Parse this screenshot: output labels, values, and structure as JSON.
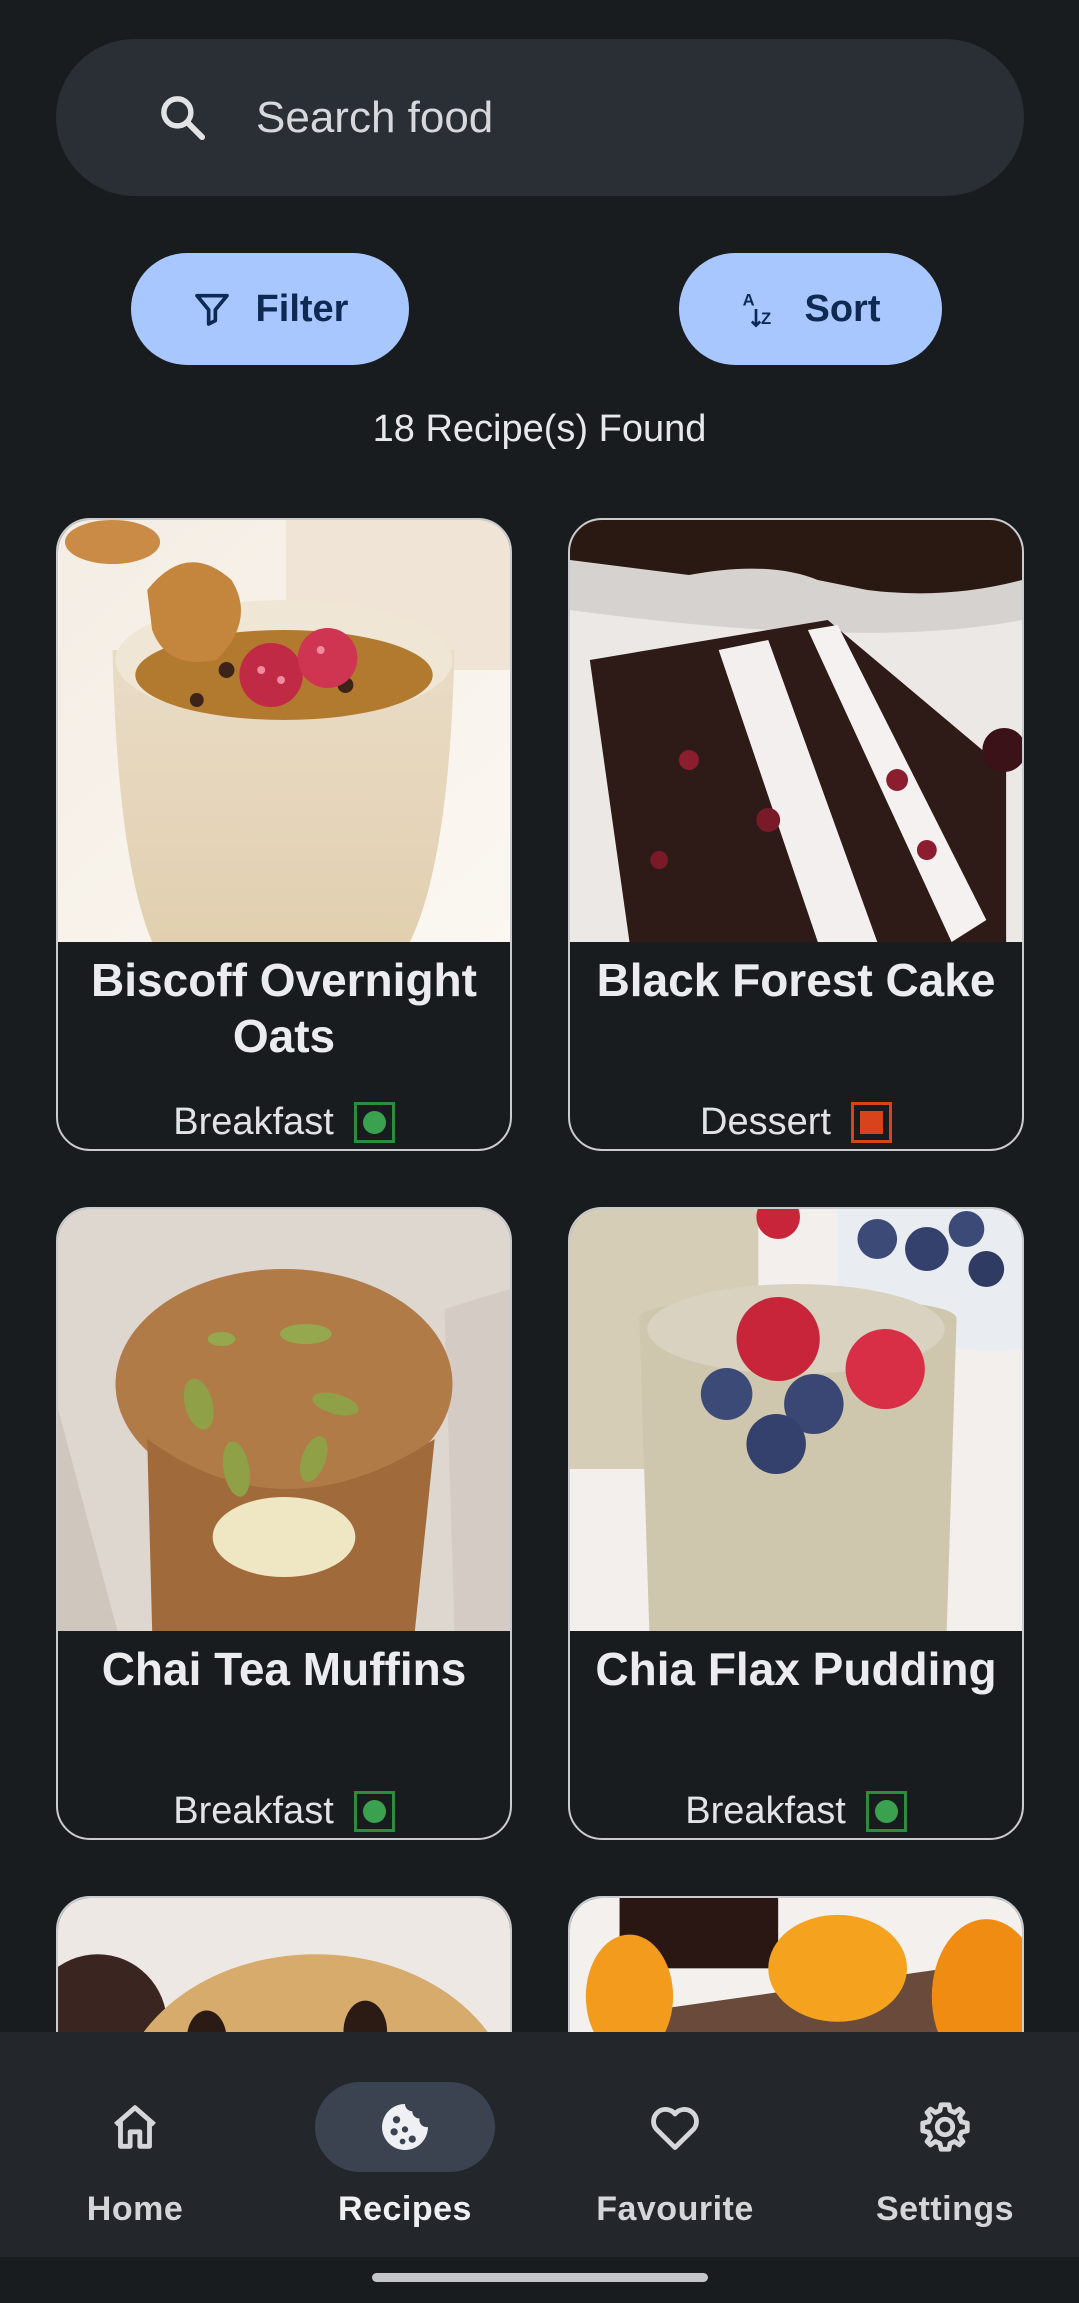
{
  "search": {
    "placeholder": "Search food",
    "value": ""
  },
  "actions": {
    "filter_label": "Filter",
    "sort_label": "Sort"
  },
  "results": {
    "count_text": "18 Recipe(s) Found"
  },
  "recipes": [
    {
      "title": "Biscoff Overnight Oats",
      "category": "Breakfast",
      "diet": "veg"
    },
    {
      "title": "Black Forest Cake",
      "category": "Dessert",
      "diet": "non-veg"
    },
    {
      "title": "Chai Tea Muffins",
      "category": "Breakfast",
      "diet": "veg"
    },
    {
      "title": "Chia Flax Pudding",
      "category": "Breakfast",
      "diet": "veg"
    }
  ],
  "nav": {
    "items": [
      {
        "label": "Home",
        "icon": "home-icon"
      },
      {
        "label": "Recipes",
        "icon": "cookie-icon",
        "active": true
      },
      {
        "label": "Favourite",
        "icon": "heart-icon"
      },
      {
        "label": "Settings",
        "icon": "gear-icon"
      }
    ]
  },
  "colors": {
    "background": "#191c1f",
    "accent_button": "#a9c7ff",
    "veg": "#3aa24e",
    "non_veg": "#d8431c"
  }
}
